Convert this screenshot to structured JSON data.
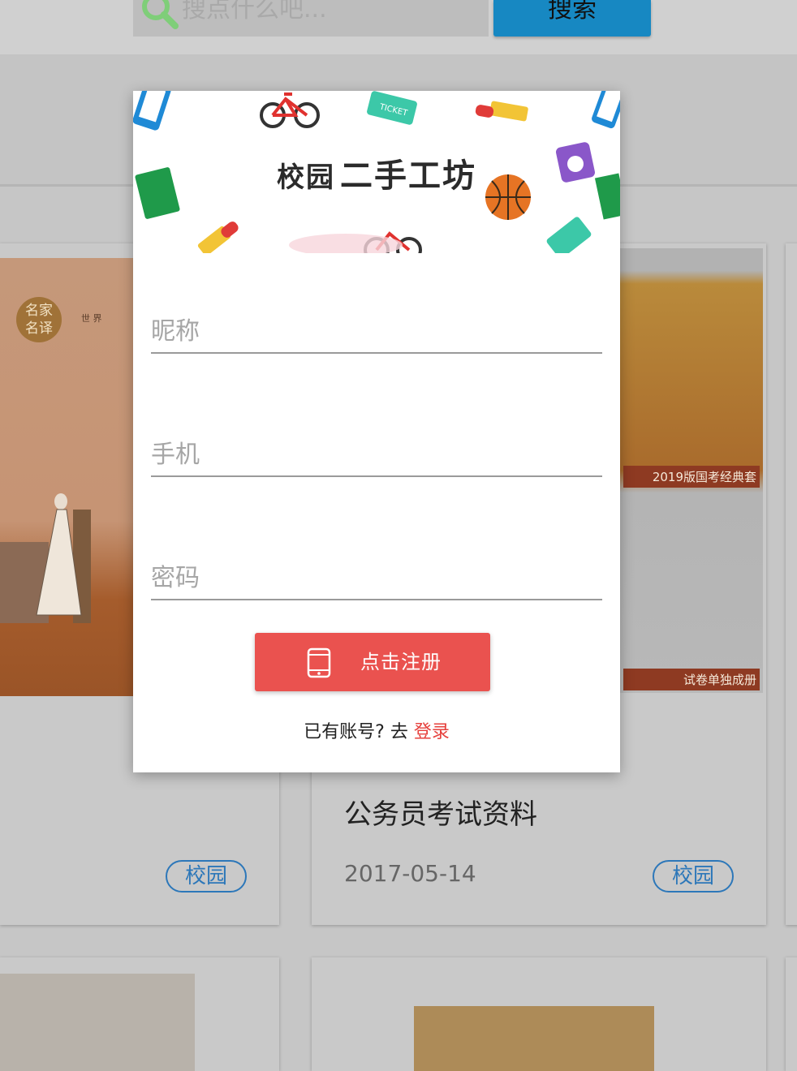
{
  "topbar": {
    "search_placeholder": "搜点什么吧...",
    "search_button": "搜索"
  },
  "cards": [
    {
      "seal_text_1": "名家",
      "seal_text_2": "名译",
      "spine_text": "世 界",
      "tag": "校园"
    },
    {
      "promo_label_1": "2019版国考经典套",
      "promo_label_2": "试卷单独成册",
      "title": "公务员考试资料",
      "date": "2017-05-14",
      "tag": "校园"
    }
  ],
  "modal": {
    "brand_lead": "校园",
    "brand_main": "二手工坊",
    "nickname_placeholder": "昵称",
    "phone_placeholder": "手机",
    "password_placeholder": "密码",
    "register_button": "点击注册",
    "login_prompt": "已有账号? 去 ",
    "login_link": "登录"
  },
  "colors": {
    "accent_red": "#ea524f",
    "link_red": "#e6403c",
    "search_blue": "#1788c2",
    "tag_blue": "#2c77b9"
  },
  "icons": [
    "search-icon",
    "phone-icon",
    "bicycle-icon",
    "ticket-icon",
    "lipstick-icon",
    "basketball-icon",
    "book-icon",
    "camera-icon"
  ]
}
